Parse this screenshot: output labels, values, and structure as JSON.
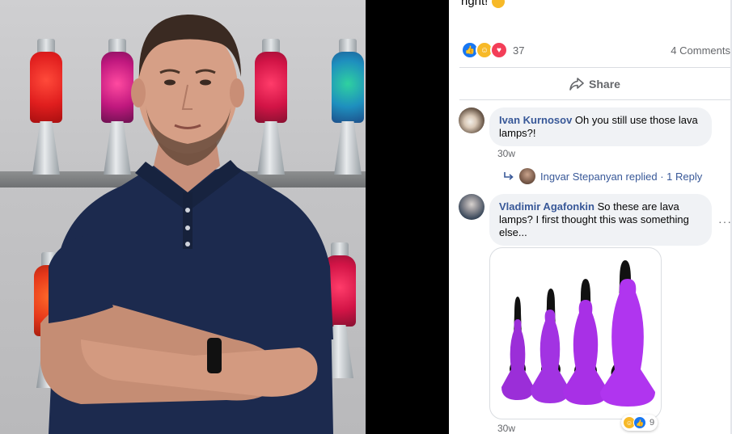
{
  "post": {
    "clipped_text": "right!",
    "reaction_count": "37",
    "comments_label": "4 Comments",
    "share_label": "Share",
    "reaction_icons": [
      "like-icon",
      "haha-icon",
      "love-icon"
    ]
  },
  "comments": [
    {
      "author": "Ivan Kurnosov",
      "text": "Oh you still use those lava lamps?!",
      "time": "30w",
      "replies": {
        "replier": "Ingvar Stepanyan",
        "action": "replied",
        "separator": "·",
        "count_label": "1 Reply"
      }
    },
    {
      "author": "Vladimir Agafonkin",
      "text": "So these are lava lamps? I first thought this was something else...",
      "time": "30w",
      "reaction_count": "9",
      "more": "···"
    }
  ],
  "colors": {
    "author_link": "#385898",
    "meta_text": "#65676b",
    "bubble_bg": "#f0f2f5",
    "like_blue": "#1877f2",
    "love_red": "#f33e58",
    "haha_yellow": "#f7b928"
  }
}
